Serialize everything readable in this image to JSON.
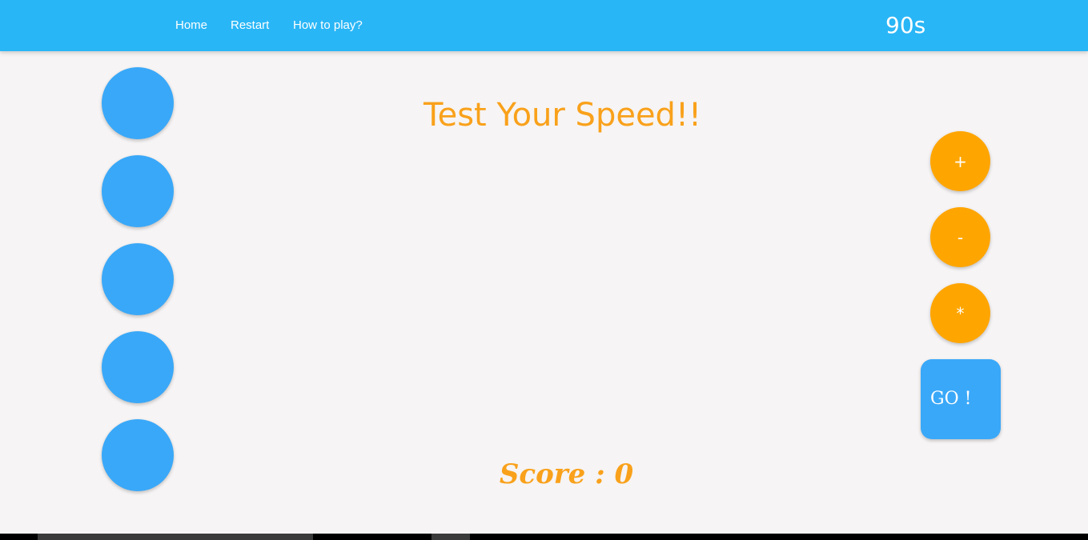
{
  "nav": {
    "items": [
      {
        "label": "Home"
      },
      {
        "label": "Restart"
      },
      {
        "label": "How to play?"
      }
    ],
    "timer": "90s"
  },
  "colors": {
    "header": "#29b6f6",
    "circle_blue": "#3aa8f8",
    "operator_orange": "#ffa500",
    "title_orange": "#f9a11b",
    "background": "#f6f4f4"
  },
  "game": {
    "title": "Test Your Speed!!",
    "operators": [
      "+",
      "-",
      "*"
    ],
    "go_label": "GO !",
    "score_text": "Score : 0"
  }
}
